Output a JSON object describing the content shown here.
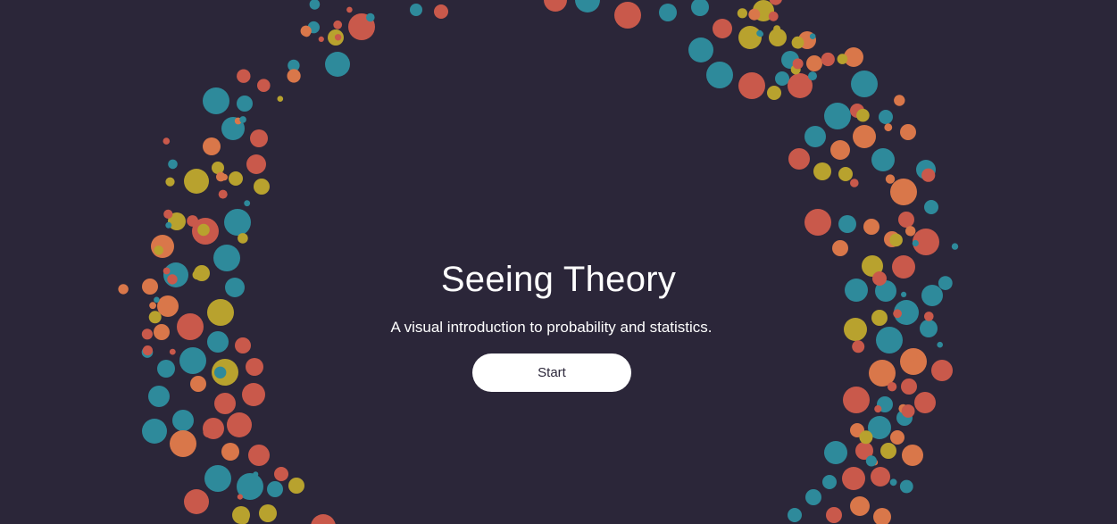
{
  "hero": {
    "title": "Seeing Theory",
    "subtitle": "A visual introduction to probability and statistics.",
    "start_label": "Start"
  },
  "palette": {
    "background": "#2b2639",
    "red": "#c9594b",
    "teal": "#2e8a9b",
    "yellow": "#b8a22e",
    "orange": "#d9774a",
    "button": "#ffffff"
  }
}
